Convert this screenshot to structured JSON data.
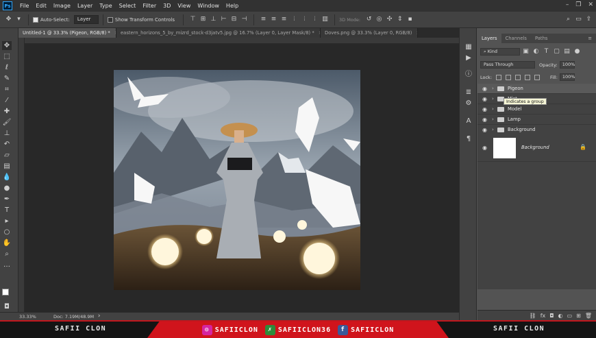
{
  "menu": [
    "File",
    "Edit",
    "Image",
    "Layer",
    "Type",
    "Select",
    "Filter",
    "3D",
    "View",
    "Window",
    "Help"
  ],
  "app_logo": "Ps",
  "options": {
    "auto_select_label": "Auto-Select:",
    "auto_select_value": "Layer",
    "transform_label": "Show Transform Controls",
    "mode_3d_label": "3D Mode:"
  },
  "tabs": [
    {
      "label": "Untitled-1 @ 33.3% (Pigeon, RGB/8) *",
      "active": true
    },
    {
      "label": "eastern_horizons_5_by_mizrd_stock-d3jatv5.jpg @ 16.7% (Layer 0, Layer Mask/8) *",
      "active": false
    },
    {
      "label": "Doves.png @ 33.3% (Layer 0, RGB/8)",
      "active": false
    }
  ],
  "status": {
    "zoom": "33.33%",
    "doc": "Doc: 7.19M/48.9M"
  },
  "panel": {
    "tabs": [
      "Layers",
      "Channels",
      "Paths"
    ],
    "kind_label": "Kind",
    "blend_mode": "Pass Through",
    "opacity_label": "Opacity:",
    "opacity_value": "100%",
    "lock_label": "Lock:",
    "fill_label": "Fill:",
    "fill_value": "100%",
    "tooltip": "Indicates a group",
    "layers": [
      {
        "name": "Pigeon",
        "selected": true
      },
      {
        "name": "Mist",
        "selected": false
      },
      {
        "name": "Model",
        "selected": false
      },
      {
        "name": "Lamp",
        "selected": false
      },
      {
        "name": "Background",
        "selected": false
      }
    ],
    "background_layer": "Background"
  },
  "banner": {
    "left_name": "SAFII CLON",
    "instagram": "SAFIICLON",
    "discord": "SAFIICLON36",
    "facebook": "SAFIICLON",
    "right_name": "SAFII CLON"
  }
}
